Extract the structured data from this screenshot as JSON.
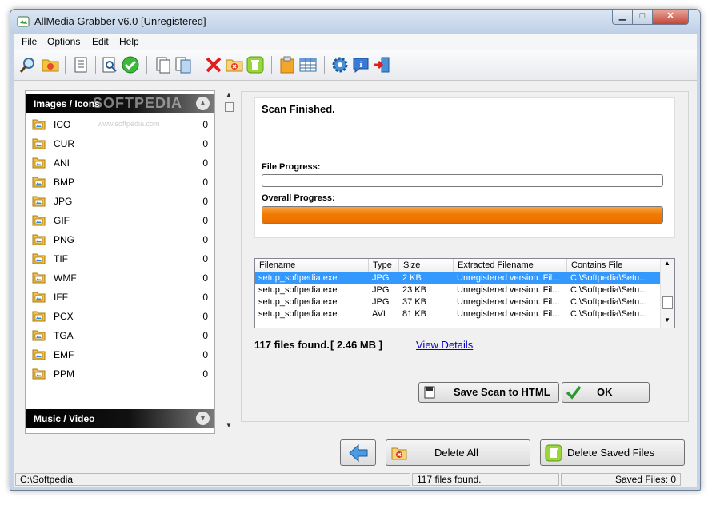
{
  "window": {
    "title": "AllMedia Grabber v6.0 [Unregistered]"
  },
  "menu": {
    "items": [
      "File",
      "Options",
      "Edit",
      "Help"
    ]
  },
  "toolbar": {
    "icons": [
      "search-icon",
      "open-folder-icon",
      "list-icon",
      "preview-icon",
      "check-icon",
      "copy-icon",
      "copy-multiple-icon",
      "delete-icon",
      "delete-folder-icon",
      "trash-icon",
      "clipboard-icon",
      "table-icon",
      "settings-gear-icon",
      "info-icon",
      "exit-icon"
    ]
  },
  "left_panel": {
    "images_header": "Images / Icons",
    "watermark": "SOFTPEDIA",
    "watermark_url": "www.softpedia.com",
    "formats": [
      {
        "name": "ICO",
        "count": "0"
      },
      {
        "name": "CUR",
        "count": "0"
      },
      {
        "name": "ANI",
        "count": "0"
      },
      {
        "name": "BMP",
        "count": "0"
      },
      {
        "name": "JPG",
        "count": "0"
      },
      {
        "name": "GIF",
        "count": "0"
      },
      {
        "name": "PNG",
        "count": "0"
      },
      {
        "name": "TIF",
        "count": "0"
      },
      {
        "name": "WMF",
        "count": "0"
      },
      {
        "name": "IFF",
        "count": "0"
      },
      {
        "name": "PCX",
        "count": "0"
      },
      {
        "name": "TGA",
        "count": "0"
      },
      {
        "name": "EMF",
        "count": "0"
      },
      {
        "name": "PPM",
        "count": "0"
      }
    ],
    "music_header": "Music / Video"
  },
  "scan": {
    "status": "Scan Finished.",
    "file_progress_label": "File Progress:",
    "file_progress": 0.0,
    "overall_progress_label": "Overall Progress:",
    "overall_progress": 1.0
  },
  "results": {
    "columns": [
      "Filename",
      "Type",
      "Size",
      "Extracted Filename",
      "Contains File"
    ],
    "rows": [
      {
        "filename": "setup_softpedia.exe",
        "type": "JPG",
        "size": "2 KB",
        "extracted": "Unregistered version. Fil...",
        "contains": "C:\\Softpedia\\Setu...",
        "selected": true
      },
      {
        "filename": "setup_softpedia.exe",
        "type": "JPG",
        "size": "23 KB",
        "extracted": "Unregistered version. Fil...",
        "contains": "C:\\Softpedia\\Setu...",
        "selected": false
      },
      {
        "filename": "setup_softpedia.exe",
        "type": "JPG",
        "size": "37 KB",
        "extracted": "Unregistered version. Fil...",
        "contains": "C:\\Softpedia\\Setu...",
        "selected": false
      },
      {
        "filename": "setup_softpedia.exe",
        "type": "AVI",
        "size": "81 KB",
        "extracted": "Unregistered version. Fil...",
        "contains": "C:\\Softpedia\\Setu...",
        "selected": false
      }
    ]
  },
  "summary": {
    "files_found": "117 files found.",
    "size": "[ 2.46 MB ]",
    "view_details": "View Details"
  },
  "buttons": {
    "save_scan": "Save Scan to HTML",
    "ok": "OK",
    "delete_all": "Delete All",
    "delete_saved": "Delete Saved Files"
  },
  "statusbar": {
    "path": "C:\\Softpedia",
    "files_found": "117 files found.",
    "saved_files": "Saved Files: 0"
  },
  "colors": {
    "progress_orange": "#f17c00",
    "selection_blue": "#3399ff",
    "link_blue": "#0000cc"
  }
}
